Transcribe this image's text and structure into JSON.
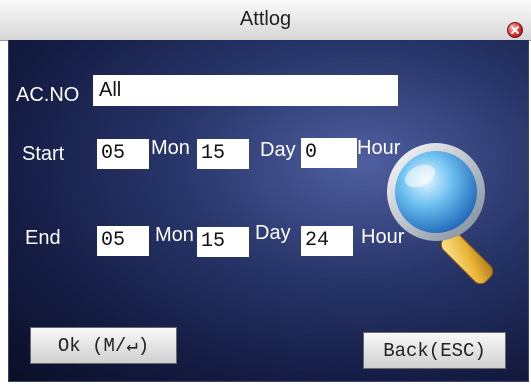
{
  "window": {
    "title": "Attlog",
    "close_icon": "close-icon"
  },
  "form": {
    "ac_no": {
      "label": "AC.NO",
      "value": "All"
    },
    "start": {
      "label": "Start",
      "month": "05",
      "month_unit": "Mon",
      "day": "15",
      "day_unit": "Day",
      "hour": "0",
      "hour_unit": "Hour"
    },
    "end": {
      "label": "End",
      "month": "05",
      "month_unit": "Mon",
      "day": "15",
      "day_unit": "Day",
      "hour": "24",
      "hour_unit": "Hour"
    }
  },
  "buttons": {
    "ok": {
      "label": "Ok (M/↵)"
    },
    "back": {
      "label": "Back(ESC)"
    }
  },
  "decor": {
    "icon": "magnifier-icon"
  },
  "colors": {
    "panel_bg": "#1c2552",
    "label_text": "#ffffff",
    "field_bg": "#ffffff",
    "magnifier_lens": "#4aa8e6",
    "magnifier_handle": "#e9b638"
  }
}
